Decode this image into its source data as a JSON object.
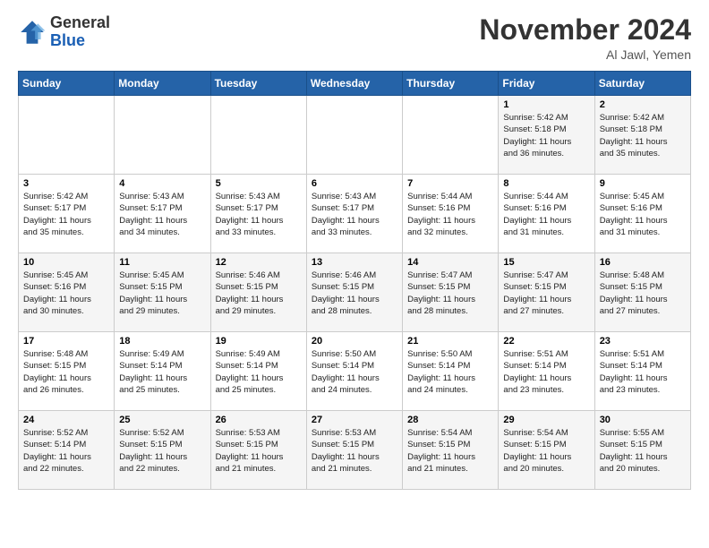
{
  "header": {
    "logo_general": "General",
    "logo_blue": "Blue",
    "month_title": "November 2024",
    "location": "Al Jawl, Yemen"
  },
  "weekdays": [
    "Sunday",
    "Monday",
    "Tuesday",
    "Wednesday",
    "Thursday",
    "Friday",
    "Saturday"
  ],
  "weeks": [
    [
      {
        "day": "",
        "info": ""
      },
      {
        "day": "",
        "info": ""
      },
      {
        "day": "",
        "info": ""
      },
      {
        "day": "",
        "info": ""
      },
      {
        "day": "",
        "info": ""
      },
      {
        "day": "1",
        "info": "Sunrise: 5:42 AM\nSunset: 5:18 PM\nDaylight: 11 hours\nand 36 minutes."
      },
      {
        "day": "2",
        "info": "Sunrise: 5:42 AM\nSunset: 5:18 PM\nDaylight: 11 hours\nand 35 minutes."
      }
    ],
    [
      {
        "day": "3",
        "info": "Sunrise: 5:42 AM\nSunset: 5:17 PM\nDaylight: 11 hours\nand 35 minutes."
      },
      {
        "day": "4",
        "info": "Sunrise: 5:43 AM\nSunset: 5:17 PM\nDaylight: 11 hours\nand 34 minutes."
      },
      {
        "day": "5",
        "info": "Sunrise: 5:43 AM\nSunset: 5:17 PM\nDaylight: 11 hours\nand 33 minutes."
      },
      {
        "day": "6",
        "info": "Sunrise: 5:43 AM\nSunset: 5:17 PM\nDaylight: 11 hours\nand 33 minutes."
      },
      {
        "day": "7",
        "info": "Sunrise: 5:44 AM\nSunset: 5:16 PM\nDaylight: 11 hours\nand 32 minutes."
      },
      {
        "day": "8",
        "info": "Sunrise: 5:44 AM\nSunset: 5:16 PM\nDaylight: 11 hours\nand 31 minutes."
      },
      {
        "day": "9",
        "info": "Sunrise: 5:45 AM\nSunset: 5:16 PM\nDaylight: 11 hours\nand 31 minutes."
      }
    ],
    [
      {
        "day": "10",
        "info": "Sunrise: 5:45 AM\nSunset: 5:16 PM\nDaylight: 11 hours\nand 30 minutes."
      },
      {
        "day": "11",
        "info": "Sunrise: 5:45 AM\nSunset: 5:15 PM\nDaylight: 11 hours\nand 29 minutes."
      },
      {
        "day": "12",
        "info": "Sunrise: 5:46 AM\nSunset: 5:15 PM\nDaylight: 11 hours\nand 29 minutes."
      },
      {
        "day": "13",
        "info": "Sunrise: 5:46 AM\nSunset: 5:15 PM\nDaylight: 11 hours\nand 28 minutes."
      },
      {
        "day": "14",
        "info": "Sunrise: 5:47 AM\nSunset: 5:15 PM\nDaylight: 11 hours\nand 28 minutes."
      },
      {
        "day": "15",
        "info": "Sunrise: 5:47 AM\nSunset: 5:15 PM\nDaylight: 11 hours\nand 27 minutes."
      },
      {
        "day": "16",
        "info": "Sunrise: 5:48 AM\nSunset: 5:15 PM\nDaylight: 11 hours\nand 27 minutes."
      }
    ],
    [
      {
        "day": "17",
        "info": "Sunrise: 5:48 AM\nSunset: 5:15 PM\nDaylight: 11 hours\nand 26 minutes."
      },
      {
        "day": "18",
        "info": "Sunrise: 5:49 AM\nSunset: 5:14 PM\nDaylight: 11 hours\nand 25 minutes."
      },
      {
        "day": "19",
        "info": "Sunrise: 5:49 AM\nSunset: 5:14 PM\nDaylight: 11 hours\nand 25 minutes."
      },
      {
        "day": "20",
        "info": "Sunrise: 5:50 AM\nSunset: 5:14 PM\nDaylight: 11 hours\nand 24 minutes."
      },
      {
        "day": "21",
        "info": "Sunrise: 5:50 AM\nSunset: 5:14 PM\nDaylight: 11 hours\nand 24 minutes."
      },
      {
        "day": "22",
        "info": "Sunrise: 5:51 AM\nSunset: 5:14 PM\nDaylight: 11 hours\nand 23 minutes."
      },
      {
        "day": "23",
        "info": "Sunrise: 5:51 AM\nSunset: 5:14 PM\nDaylight: 11 hours\nand 23 minutes."
      }
    ],
    [
      {
        "day": "24",
        "info": "Sunrise: 5:52 AM\nSunset: 5:14 PM\nDaylight: 11 hours\nand 22 minutes."
      },
      {
        "day": "25",
        "info": "Sunrise: 5:52 AM\nSunset: 5:15 PM\nDaylight: 11 hours\nand 22 minutes."
      },
      {
        "day": "26",
        "info": "Sunrise: 5:53 AM\nSunset: 5:15 PM\nDaylight: 11 hours\nand 21 minutes."
      },
      {
        "day": "27",
        "info": "Sunrise: 5:53 AM\nSunset: 5:15 PM\nDaylight: 11 hours\nand 21 minutes."
      },
      {
        "day": "28",
        "info": "Sunrise: 5:54 AM\nSunset: 5:15 PM\nDaylight: 11 hours\nand 21 minutes."
      },
      {
        "day": "29",
        "info": "Sunrise: 5:54 AM\nSunset: 5:15 PM\nDaylight: 11 hours\nand 20 minutes."
      },
      {
        "day": "30",
        "info": "Sunrise: 5:55 AM\nSunset: 5:15 PM\nDaylight: 11 hours\nand 20 minutes."
      }
    ]
  ]
}
